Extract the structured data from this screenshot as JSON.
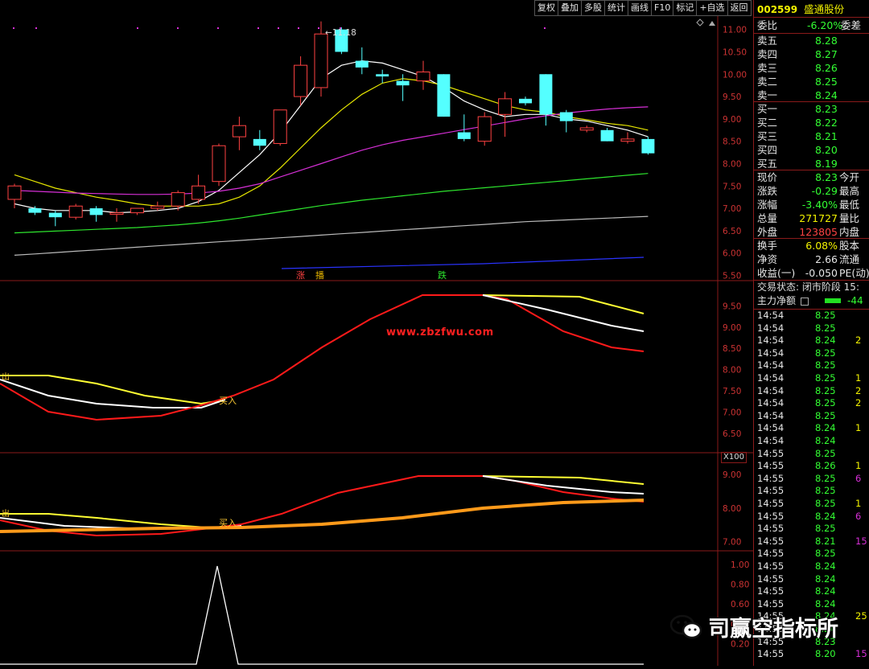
{
  "toolbar": {
    "buttons": [
      "复权",
      "叠加",
      "多股",
      "统计",
      "画线",
      "F10",
      "标记",
      "+自选",
      "返回"
    ]
  },
  "stock": {
    "code": "002599",
    "name": "盛通股份"
  },
  "main_chart": {
    "y_labels": [
      "11.00",
      "10.50",
      "10.00",
      "9.50",
      "9.00",
      "8.50",
      "8.00",
      "7.50",
      "7.00",
      "6.50",
      "6.00",
      "5.50"
    ],
    "peak_label": "11.18",
    "markers": [
      "涨",
      "播",
      "跌"
    ]
  },
  "ind1": {
    "y_labels": [
      "9.50",
      "9.00",
      "8.50",
      "8.00",
      "7.50",
      "7.00",
      "6.50"
    ],
    "watermark": "www.zbzfwu.com",
    "buy_label": "买入",
    "left_label": "出"
  },
  "ind2": {
    "scale_label": "X100",
    "y_labels": [
      "9.00",
      "8.00",
      "7.00"
    ],
    "buy_label": "买入",
    "left_label": "出"
  },
  "ind3": {
    "y_labels": [
      "1.00",
      "0.80",
      "0.60",
      "0.40",
      "0.20"
    ]
  },
  "quote": {
    "weibi_label": "委比",
    "weibi_value": "-6.20%",
    "weicha_label": "委差",
    "asks": [
      {
        "label": "卖五",
        "price": "8.28"
      },
      {
        "label": "卖四",
        "price": "8.27"
      },
      {
        "label": "卖三",
        "price": "8.26"
      },
      {
        "label": "卖二",
        "price": "8.25"
      },
      {
        "label": "卖一",
        "price": "8.24"
      }
    ],
    "bids": [
      {
        "label": "买一",
        "price": "8.23"
      },
      {
        "label": "买二",
        "price": "8.22"
      },
      {
        "label": "买三",
        "price": "8.21"
      },
      {
        "label": "买四",
        "price": "8.20"
      },
      {
        "label": "买五",
        "price": "8.19"
      }
    ],
    "stats": [
      {
        "label": "现价",
        "value": "8.23",
        "label2": "今开"
      },
      {
        "label": "涨跌",
        "value": "-0.29",
        "label2": "最高"
      },
      {
        "label": "涨幅",
        "value": "-3.40%",
        "label2": "最低"
      },
      {
        "label": "总量",
        "value": "271727",
        "label2": "量比"
      },
      {
        "label": "外盘",
        "value": "123805",
        "label2": "内盘"
      }
    ],
    "stats2": [
      {
        "label": "换手",
        "value": "6.08%",
        "label2": "股本"
      },
      {
        "label": "净资",
        "value": "2.66",
        "label2": "流通"
      },
      {
        "label": "收益(一)",
        "value": "-0.050",
        "label2": "PE(动)"
      }
    ],
    "trade_status": "交易状态: 闭市阶段 15:",
    "main_net_label": "主力净额",
    "main_net_value": "-44"
  },
  "ticks": [
    {
      "t": "14:54",
      "p": "8.25",
      "v": ""
    },
    {
      "t": "14:54",
      "p": "8.25",
      "v": ""
    },
    {
      "t": "14:54",
      "p": "8.24",
      "v": "2"
    },
    {
      "t": "14:54",
      "p": "8.25",
      "v": ""
    },
    {
      "t": "14:54",
      "p": "8.25",
      "v": ""
    },
    {
      "t": "14:54",
      "p": "8.25",
      "v": "1"
    },
    {
      "t": "14:54",
      "p": "8.25",
      "v": "2"
    },
    {
      "t": "14:54",
      "p": "8.25",
      "v": "2"
    },
    {
      "t": "14:54",
      "p": "8.25",
      "v": ""
    },
    {
      "t": "14:54",
      "p": "8.24",
      "v": "1"
    },
    {
      "t": "14:54",
      "p": "8.24",
      "v": ""
    },
    {
      "t": "14:55",
      "p": "8.25",
      "v": ""
    },
    {
      "t": "14:55",
      "p": "8.26",
      "v": "1"
    },
    {
      "t": "14:55",
      "p": "8.25",
      "v": "6"
    },
    {
      "t": "14:55",
      "p": "8.25",
      "v": ""
    },
    {
      "t": "14:55",
      "p": "8.25",
      "v": "1"
    },
    {
      "t": "14:55",
      "p": "8.24",
      "v": "6"
    },
    {
      "t": "14:55",
      "p": "8.25",
      "v": ""
    },
    {
      "t": "14:55",
      "p": "8.21",
      "v": "15"
    },
    {
      "t": "14:55",
      "p": "8.25",
      "v": ""
    },
    {
      "t": "14:55",
      "p": "8.24",
      "v": ""
    },
    {
      "t": "14:55",
      "p": "8.24",
      "v": ""
    },
    {
      "t": "14:55",
      "p": "8.24",
      "v": ""
    },
    {
      "t": "14:55",
      "p": "8.24",
      "v": ""
    },
    {
      "t": "14:55",
      "p": "8.24",
      "v": "25"
    },
    {
      "t": "14:55",
      "p": "8.24",
      "v": ""
    },
    {
      "t": "14:55",
      "p": "8.23",
      "v": ""
    },
    {
      "t": "14:55",
      "p": "8.20",
      "v": "15"
    }
  ],
  "watermark_brand": "司赢空指标所",
  "colors": {
    "up": "#ff4242",
    "down": "#54ffff",
    "ma5": "#ffffff",
    "ma10": "#e6e600",
    "ma20": "#d62fd6",
    "ma60": "#2ee62e",
    "ma120": "#bbbbbb",
    "ma250": "#2a33ff",
    "orange": "#ff9a1a"
  },
  "chart_data": [
    {
      "type": "candlestick",
      "title": "",
      "ylim": [
        5.4,
        11.3
      ],
      "candles": [
        {
          "o": 7.2,
          "c": 7.5,
          "h": 7.55,
          "l": 7.0
        },
        {
          "o": 7.0,
          "c": 6.9,
          "h": 7.05,
          "l": 6.85
        },
        {
          "o": 6.9,
          "c": 6.8,
          "h": 6.95,
          "l": 6.6
        },
        {
          "o": 6.8,
          "c": 7.05,
          "h": 7.1,
          "l": 6.75
        },
        {
          "o": 7.0,
          "c": 6.85,
          "h": 7.05,
          "l": 6.7
        },
        {
          "o": 6.9,
          "c": 6.9,
          "h": 7.0,
          "l": 6.7
        },
        {
          "o": 6.9,
          "c": 7.0,
          "h": 7.0,
          "l": 6.85
        },
        {
          "o": 7.0,
          "c": 7.05,
          "h": 7.15,
          "l": 6.95
        },
        {
          "o": 7.05,
          "c": 7.35,
          "h": 7.4,
          "l": 6.95
        },
        {
          "o": 7.2,
          "c": 7.5,
          "h": 7.75,
          "l": 7.1
        },
        {
          "o": 7.6,
          "c": 8.4,
          "h": 8.45,
          "l": 7.5
        },
        {
          "o": 8.6,
          "c": 8.85,
          "h": 9.05,
          "l": 8.3
        },
        {
          "o": 8.55,
          "c": 8.4,
          "h": 8.75,
          "l": 8.3
        },
        {
          "o": 8.45,
          "c": 9.2,
          "h": 9.2,
          "l": 8.4
        },
        {
          "o": 9.5,
          "c": 10.2,
          "h": 10.4,
          "l": 9.3
        },
        {
          "o": 9.7,
          "c": 10.9,
          "h": 11.18,
          "l": 9.5
        },
        {
          "o": 11.0,
          "c": 10.5,
          "h": 11.05,
          "l": 10.45
        },
        {
          "o": 10.3,
          "c": 10.15,
          "h": 10.6,
          "l": 10.0
        },
        {
          "o": 10.0,
          "c": 9.95,
          "h": 10.1,
          "l": 9.8
        },
        {
          "o": 9.85,
          "c": 9.75,
          "h": 10.0,
          "l": 9.4
        },
        {
          "o": 9.85,
          "c": 10.05,
          "h": 10.3,
          "l": 9.65
        },
        {
          "o": 10.0,
          "c": 9.05,
          "h": 10.0,
          "l": 9.05
        },
        {
          "o": 8.7,
          "c": 8.55,
          "h": 9.1,
          "l": 8.5
        },
        {
          "o": 8.5,
          "c": 9.05,
          "h": 9.15,
          "l": 8.4
        },
        {
          "o": 9.1,
          "c": 9.45,
          "h": 9.6,
          "l": 8.6
        },
        {
          "o": 9.45,
          "c": 9.35,
          "h": 9.5,
          "l": 9.3
        },
        {
          "o": 10.0,
          "c": 9.1,
          "h": 10.0,
          "l": 8.85
        },
        {
          "o": 9.15,
          "c": 8.95,
          "h": 9.2,
          "l": 8.7
        },
        {
          "o": 8.75,
          "c": 8.8,
          "h": 8.85,
          "l": 8.7
        },
        {
          "o": 8.75,
          "c": 8.5,
          "h": 8.8,
          "l": 8.5
        },
        {
          "o": 8.5,
          "c": 8.55,
          "h": 8.7,
          "l": 8.45
        },
        {
          "o": 8.55,
          "c": 8.23,
          "h": 8.6,
          "l": 8.2
        }
      ],
      "series": [
        {
          "color": "ma5",
          "values": [
            7.1,
            7.0,
            6.95,
            6.95,
            6.95,
            6.9,
            6.92,
            6.95,
            7.0,
            7.15,
            7.4,
            7.8,
            8.2,
            8.7,
            9.3,
            9.9,
            10.2,
            10.3,
            10.25,
            10.1,
            9.95,
            9.7,
            9.4,
            9.2,
            9.05,
            9.1,
            9.1,
            9.0,
            8.95,
            8.85,
            8.75,
            8.6
          ]
        },
        {
          "color": "ma10",
          "values": [
            7.75,
            7.6,
            7.45,
            7.35,
            7.25,
            7.18,
            7.1,
            7.05,
            7.05,
            7.05,
            7.1,
            7.25,
            7.5,
            7.9,
            8.35,
            8.8,
            9.2,
            9.55,
            9.8,
            9.9,
            9.85,
            9.75,
            9.6,
            9.45,
            9.3,
            9.2,
            9.15,
            9.05,
            8.98,
            8.9,
            8.85,
            8.75
          ]
        },
        {
          "color": "ma20",
          "values": [
            7.4,
            7.38,
            7.36,
            7.34,
            7.33,
            7.32,
            7.31,
            7.31,
            7.32,
            7.34,
            7.38,
            7.45,
            7.55,
            7.7,
            7.85,
            8.0,
            8.15,
            8.3,
            8.42,
            8.52,
            8.6,
            8.68,
            8.76,
            8.84,
            8.92,
            9.0,
            9.07,
            9.13,
            9.18,
            9.22,
            9.25,
            9.27
          ]
        },
        {
          "color": "ma60",
          "values": [
            6.45,
            6.47,
            6.49,
            6.51,
            6.53,
            6.55,
            6.57,
            6.6,
            6.63,
            6.67,
            6.72,
            6.78,
            6.85,
            6.92,
            6.99,
            7.06,
            7.12,
            7.18,
            7.23,
            7.28,
            7.33,
            7.38,
            7.42,
            7.46,
            7.5,
            7.54,
            7.58,
            7.62,
            7.66,
            7.7,
            7.74,
            7.78
          ]
        },
        {
          "color": "ma120",
          "values": [
            5.95,
            5.98,
            6.01,
            6.04,
            6.07,
            6.1,
            6.13,
            6.16,
            6.19,
            6.22,
            6.25,
            6.28,
            6.31,
            6.34,
            6.37,
            6.4,
            6.43,
            6.46,
            6.49,
            6.52,
            6.55,
            6.58,
            6.61,
            6.64,
            6.67,
            6.7,
            6.72,
            6.74,
            6.76,
            6.78,
            6.8,
            6.82
          ]
        }
      ]
    }
  ]
}
